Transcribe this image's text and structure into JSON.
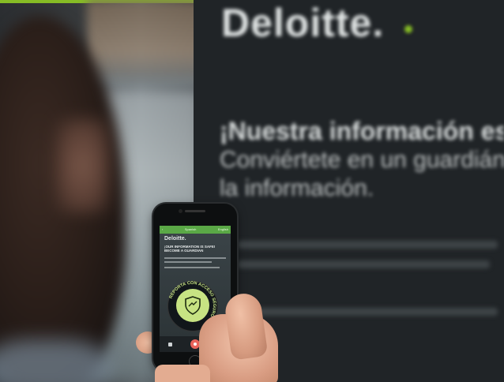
{
  "background_board": {
    "brand": "Deloitte.",
    "heading_line1": "¡Nuestra información es",
    "heading_line2": "Conviértete en un guardián",
    "heading_line3": "la información."
  },
  "phone_app": {
    "topbar_left": "‹",
    "topbar_center": "Spanish",
    "topbar_right": "English",
    "brand": "Deloitte.",
    "headline": "¡OUR INFORMATION IS SAFE! BECOME A GUARDIAN",
    "badge_text": "REPORTA CON ACCESO SEGURO"
  },
  "colors": {
    "accent_green": "#86bc25",
    "record_button": "#e8635a",
    "badge_fill": "#c7e383"
  }
}
